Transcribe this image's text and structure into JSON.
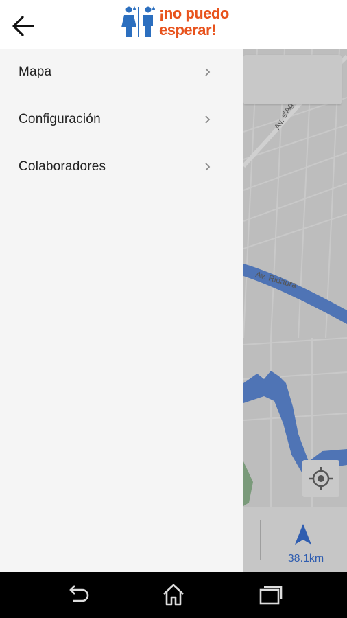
{
  "app": {
    "logo_line1": "¡no puedo",
    "logo_line2": "esperar!",
    "brand_color": "#e8531d",
    "logo_figure_color": "#2c6fbf"
  },
  "drawer": {
    "items": [
      {
        "label": "Mapa",
        "icon": "chevron-right-icon"
      },
      {
        "label": "Configuración",
        "icon": "chevron-right-icon"
      },
      {
        "label": "Colaboradores",
        "icon": "chevron-right-icon"
      }
    ]
  },
  "map": {
    "street_labels": [
      "Av. s'Agaró",
      "Av. Ridaura"
    ],
    "distance": "38.1km",
    "water_color": "#4f74b5"
  },
  "system_nav": {
    "buttons": [
      "back-icon",
      "home-icon",
      "recents-icon"
    ]
  }
}
